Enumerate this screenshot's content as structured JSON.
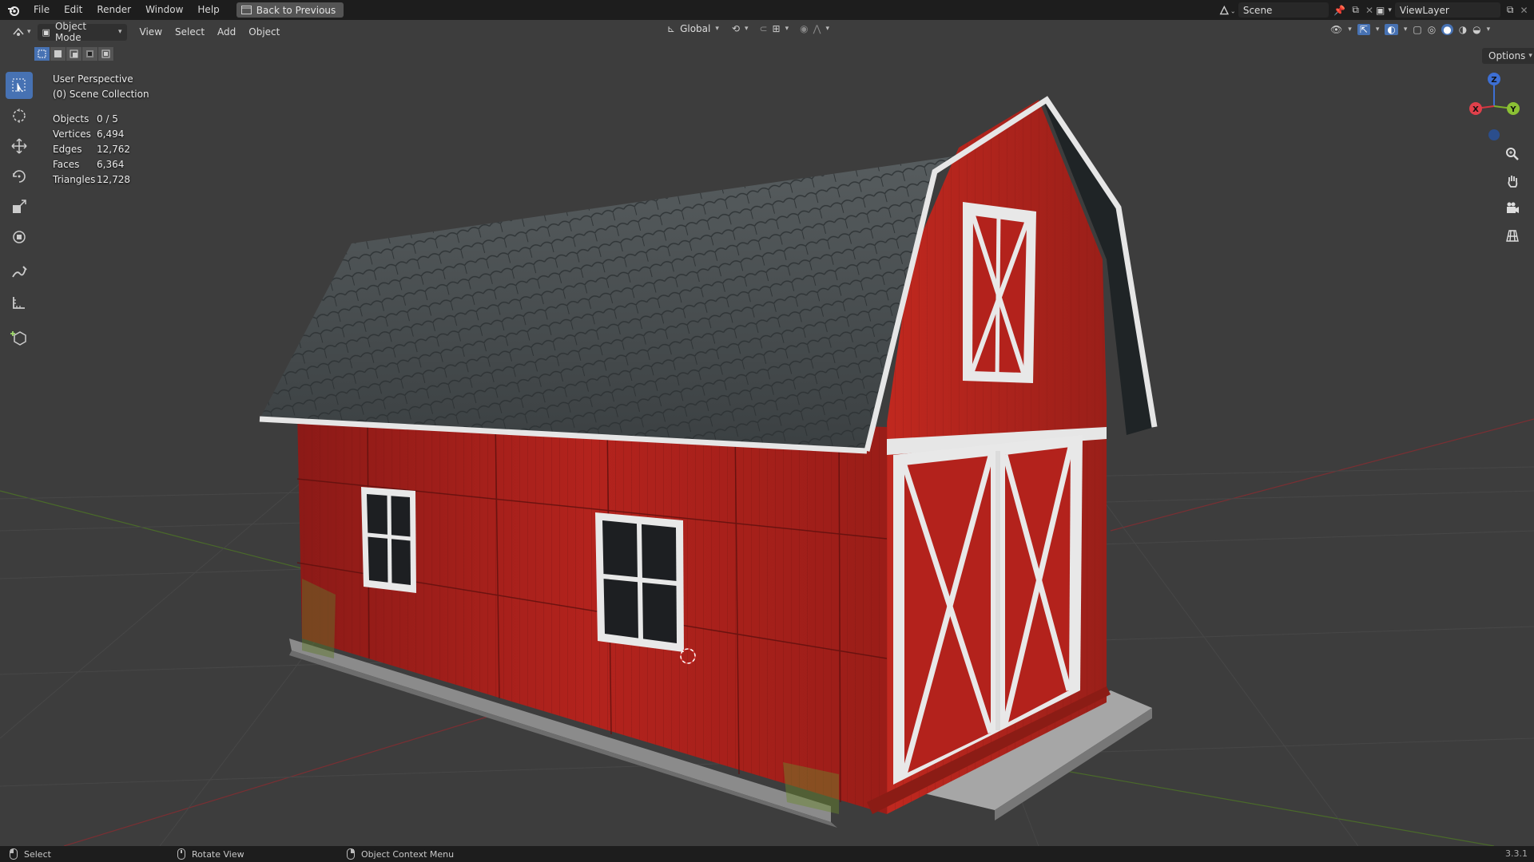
{
  "menubar": {
    "items": [
      "File",
      "Edit",
      "Render",
      "Window",
      "Help"
    ],
    "back_button": "Back to Previous",
    "scene_name": "Scene",
    "view_layer": "ViewLayer"
  },
  "header": {
    "mode": "Object Mode",
    "menus": [
      "View",
      "Select",
      "Add",
      "Object"
    ],
    "transform_orientation": "Global",
    "options": "Options"
  },
  "overlay": {
    "view_name": "User Perspective",
    "collection": "(0) Scene Collection"
  },
  "stats": [
    {
      "label": "Objects",
      "value": "0 / 5"
    },
    {
      "label": "Vertices",
      "value": "6,494"
    },
    {
      "label": "Edges",
      "value": "12,762"
    },
    {
      "label": "Faces",
      "value": "6,364"
    },
    {
      "label": "Triangles",
      "value": "12,728"
    }
  ],
  "gizmo": {
    "x": "X",
    "y": "Y",
    "z": "Z"
  },
  "statusbar": {
    "select": "Select",
    "rotate": "Rotate View",
    "context": "Object Context Menu",
    "version": "3.3.1"
  },
  "colors": {
    "barn_red": "#b3211c",
    "roof": "#44494b",
    "trim": "#e8e8e8",
    "active_tool": "#4772b3"
  }
}
